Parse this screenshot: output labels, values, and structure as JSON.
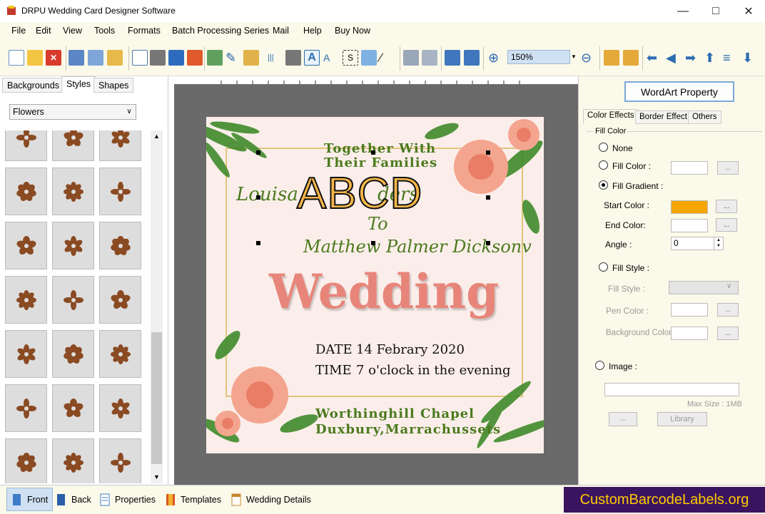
{
  "window": {
    "title": "DRPU Wedding Card Designer Software"
  },
  "menu": [
    "File",
    "Edit",
    "View",
    "Tools",
    "Formats",
    "Batch Processing Series",
    "Mail",
    "Help",
    "Buy Now"
  ],
  "toolbar": {
    "zoom": "150%"
  },
  "left_panel": {
    "tabs": [
      "Backgrounds",
      "Styles",
      "Shapes"
    ],
    "active_tab": "Styles",
    "category": "Flowers"
  },
  "card": {
    "line1": "Together With",
    "line2": "Their Families",
    "bride": "Louisa",
    "bride_surname_partial": "ders",
    "wordart": "ABCD",
    "to": "To",
    "groom": "Matthew Palmer Dicksonv",
    "headline": "Wedding",
    "date_label": "DATE",
    "date_value": "14 Febrary 2020",
    "time_label": "TIME",
    "time_value": "7 o'clock in the evening",
    "venue1": "Worthinghill Chapel",
    "venue2": "Duxbury,Marrachussets"
  },
  "right_panel": {
    "wordart_button": "WordArt Property",
    "tabs": [
      "Color Effects",
      "Border Effect",
      "Others"
    ],
    "group_title": "Fill Color",
    "none": "None",
    "fill_color": "Fill Color :",
    "fill_gradient": "Fill Gradient :",
    "start_color": "Start Color :",
    "start_color_value": "#f7a500",
    "end_color": "End Color:",
    "angle": "Angle :",
    "angle_value": "0",
    "fill_style_radio": "Fill Style :",
    "fill_style": "Fill Style :",
    "pen_color": "Pen Color :",
    "background_color": "Background Color :",
    "image": "Image :",
    "max_size": "Max Size : 1MB",
    "library": "Library",
    "dots": "..."
  },
  "bottom_tabs": [
    "Front",
    "Back",
    "Properties",
    "Templates",
    "Wedding Details"
  ],
  "watermark": "CustomBarcodeLabels.org",
  "colors": {
    "accent": "#3b1460",
    "watermark_text": "#ffcc00",
    "card_green": "#4b7a1e",
    "headline": "#e8857a"
  }
}
